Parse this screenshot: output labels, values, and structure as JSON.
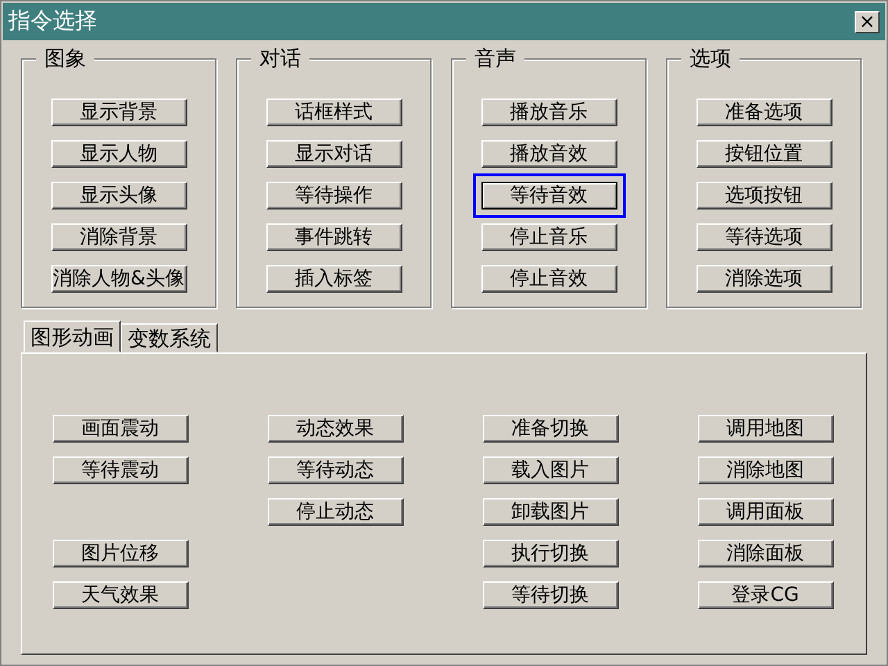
{
  "window": {
    "title": "指令选择",
    "close": "×"
  },
  "groups": [
    {
      "title": "图象",
      "buttons": [
        {
          "label": "显示背景",
          "selected": false
        },
        {
          "label": "显示人物",
          "selected": false
        },
        {
          "label": "显示头像",
          "selected": false
        },
        {
          "label": "消除背景",
          "selected": false
        },
        {
          "label": "消除人物&头像",
          "selected": false
        }
      ]
    },
    {
      "title": "对话",
      "buttons": [
        {
          "label": "话框样式",
          "selected": false
        },
        {
          "label": "显示对话",
          "selected": false
        },
        {
          "label": "等待操作",
          "selected": false
        },
        {
          "label": "事件跳转",
          "selected": false
        },
        {
          "label": "插入标签",
          "selected": false
        }
      ]
    },
    {
      "title": "音声",
      "buttons": [
        {
          "label": "播放音乐",
          "selected": false
        },
        {
          "label": "播放音效",
          "selected": false
        },
        {
          "label": "等待音效",
          "selected": true
        },
        {
          "label": "停止音乐",
          "selected": false
        },
        {
          "label": "停止音效",
          "selected": false
        }
      ]
    },
    {
      "title": "选项",
      "buttons": [
        {
          "label": "准备选项",
          "selected": false
        },
        {
          "label": "按钮位置",
          "selected": false
        },
        {
          "label": "选项按钮",
          "selected": false
        },
        {
          "label": "等待选项",
          "selected": false
        },
        {
          "label": "消除选项",
          "selected": false
        }
      ]
    }
  ],
  "tabs": [
    {
      "label": "图形动画",
      "selected": true
    },
    {
      "label": "变数系统",
      "selected": false
    }
  ],
  "tab_rows": [
    [
      "画面震动",
      "动态效果",
      "准备切换",
      "调用地图"
    ],
    [
      "等待震动",
      "等待动态",
      "载入图片",
      "消除地图"
    ],
    [
      null,
      "停止动态",
      "卸载图片",
      "调用面板"
    ],
    [
      "图片位移",
      null,
      "执行切换",
      "消除面板"
    ],
    [
      "天气效果",
      null,
      "等待切换",
      "登录CG"
    ]
  ]
}
